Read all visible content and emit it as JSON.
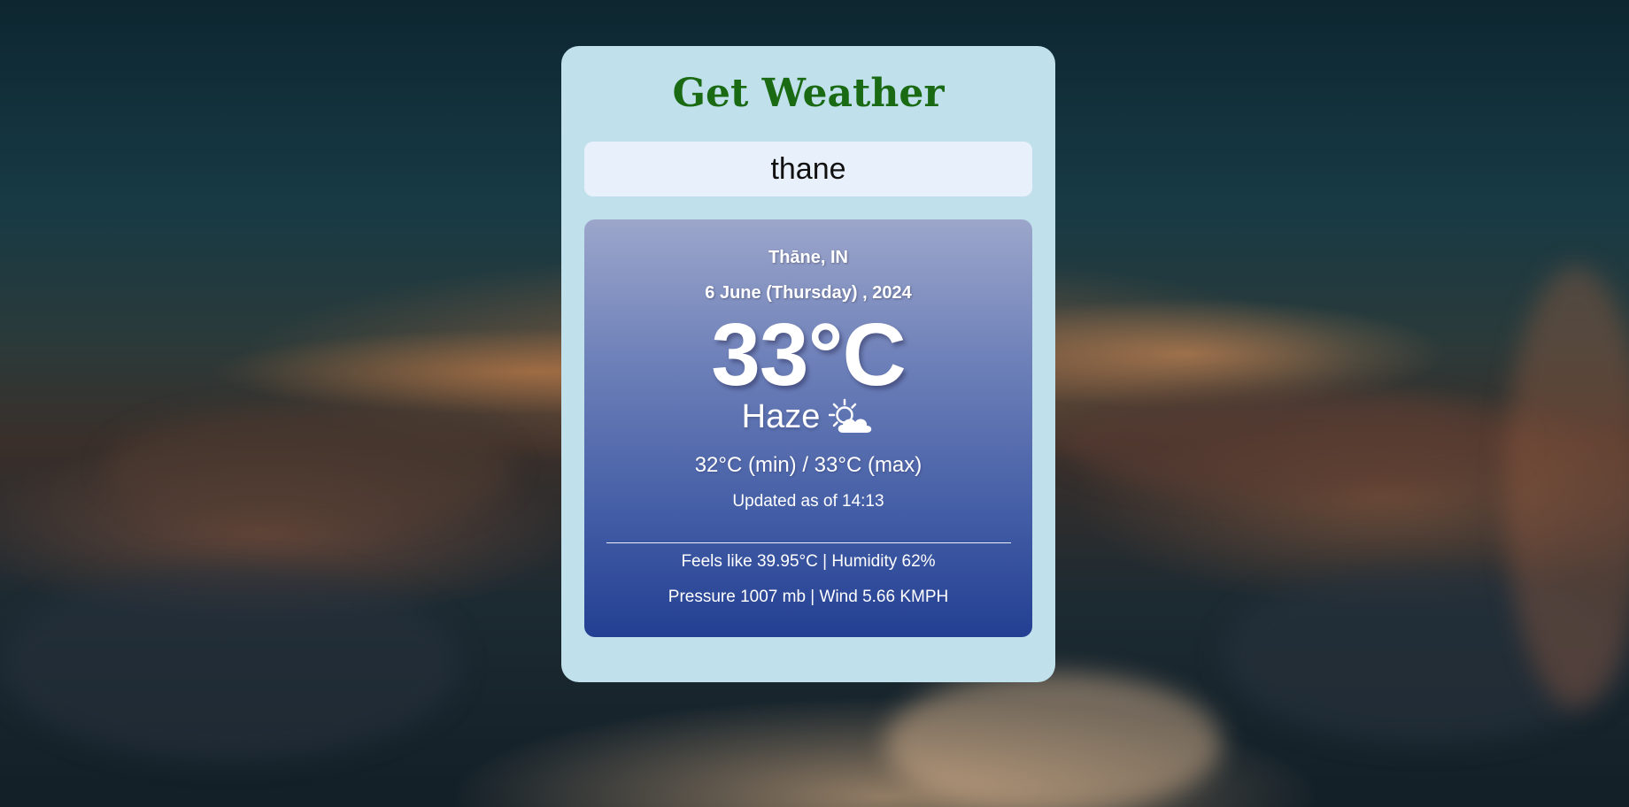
{
  "app": {
    "title": "Get Weather"
  },
  "search": {
    "value": "thane"
  },
  "weather": {
    "location": "Thāne, IN",
    "date": "6 June (Thursday) , 2024",
    "temperature": "33°C",
    "condition": "Haze",
    "condition_icon": "sun-behind-cloud-icon",
    "min_max": "32°C (min) / 33°C (max)",
    "updated": "Updated as of 14:13",
    "feels_humidity": "Feels like 39.95°C | Humidity 62%",
    "pressure_wind": "Pressure 1007 mb | Wind 5.66 KMPH"
  },
  "colors": {
    "title": "#1a6a14",
    "card": "#c0e0ec",
    "search_bg": "#e8f0fb",
    "panel_top": "#9ca6cb",
    "panel_bottom": "#233f92"
  }
}
